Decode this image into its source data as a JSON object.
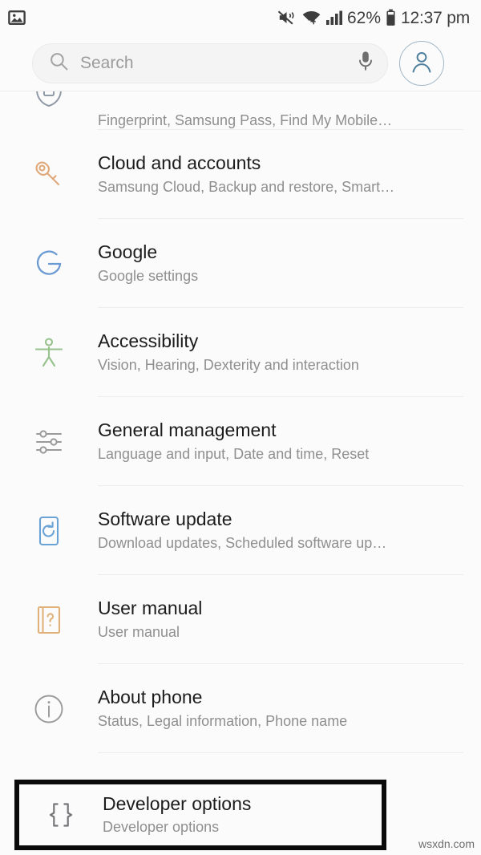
{
  "statusbar": {
    "notification_icon": "gallery-icon",
    "icons": [
      "mute-vibrate-icon",
      "wifi-icon",
      "signal-bars-icon",
      "battery-icon"
    ],
    "battery_percent": "62%",
    "time": "12:37 pm"
  },
  "search": {
    "placeholder": "Search",
    "search_icon": "search-icon",
    "mic_icon": "microphone-icon",
    "account_icon": "account-avatar-icon"
  },
  "list": {
    "items": [
      {
        "title": "",
        "subtitle": "Fingerprint, Samsung Pass, Find My Mobile…",
        "icon": "shield-lock-icon",
        "icon_color": "#8f9aa6",
        "partial": true
      },
      {
        "title": "Cloud and accounts",
        "subtitle": "Samsung Cloud, Backup and restore, Smart…",
        "icon": "key-icon",
        "icon_color": "#e0a878"
      },
      {
        "title": "Google",
        "subtitle": "Google settings",
        "icon": "google-g-icon",
        "icon_color": "#6b9bd2"
      },
      {
        "title": "Accessibility",
        "subtitle": "Vision, Hearing, Dexterity and interaction",
        "icon": "accessibility-person-icon",
        "icon_color": "#97c18d"
      },
      {
        "title": "General management",
        "subtitle": "Language and input, Date and time, Reset",
        "icon": "sliders-icon",
        "icon_color": "#9a9a9a"
      },
      {
        "title": "Software update",
        "subtitle": "Download updates, Scheduled software up…",
        "icon": "software-update-icon",
        "icon_color": "#6ba3d6"
      },
      {
        "title": "User manual",
        "subtitle": "User manual",
        "icon": "user-manual-book-icon",
        "icon_color": "#e0b178"
      },
      {
        "title": "About phone",
        "subtitle": "Status, Legal information, Phone name",
        "icon": "info-circle-icon",
        "icon_color": "#9a9a9a"
      }
    ],
    "highlighted": {
      "title": "Developer options",
      "subtitle": "Developer options",
      "icon": "curly-braces-icon",
      "icon_color": "#77777a",
      "highlight_color": "#0a0a0a"
    }
  },
  "watermark": "wsxdn.com"
}
